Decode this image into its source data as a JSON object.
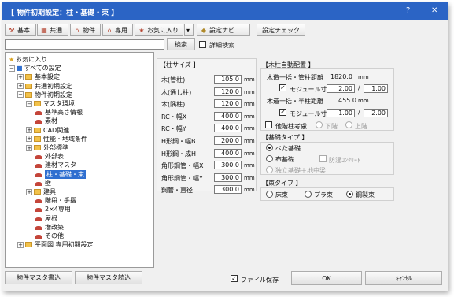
{
  "window": {
    "title": "【 物件初期設定：柱・基礎・束 】",
    "help_label": "?",
    "close_label": "✕"
  },
  "toolbar": [
    {
      "icon": "tool-icon",
      "glyph": "⚒",
      "label": "基本"
    },
    {
      "icon": "grid-icon",
      "glyph": "▦",
      "label": "共通"
    },
    {
      "icon": "house-icon",
      "glyph": "⌂",
      "label": "物件"
    },
    {
      "icon": "house-icon",
      "glyph": "⌂",
      "label": "専用"
    },
    {
      "icon": "star-icon",
      "glyph": "★",
      "label": "お気に入り"
    }
  ],
  "toolbar_dropdown": "▾",
  "nav_button": "設定ナビ",
  "check_button": "設定チェック",
  "search": {
    "value": "",
    "button": "検索",
    "detail_label": "詳細検索"
  },
  "tree": [
    {
      "label": "お気に入り",
      "kind": "star",
      "indent": 0,
      "pm": ""
    },
    {
      "label": "すべての設定",
      "kind": "book",
      "indent": 0,
      "pm": "−"
    },
    {
      "label": "基本設定",
      "kind": "folder",
      "indent": 1,
      "pm": "+"
    },
    {
      "label": "共通初期設定",
      "kind": "folder",
      "indent": 1,
      "pm": "+"
    },
    {
      "label": "物件初期設定",
      "kind": "folder",
      "indent": 1,
      "pm": "−"
    },
    {
      "label": "マスタ環境",
      "kind": "folder",
      "indent": 2,
      "pm": "−"
    },
    {
      "label": "基準高さ情報",
      "kind": "hat",
      "indent": 3,
      "pm": ""
    },
    {
      "label": "素材",
      "kind": "hat",
      "indent": 3,
      "pm": ""
    },
    {
      "label": "CAD関連",
      "kind": "folder",
      "indent": 2,
      "pm": "+"
    },
    {
      "label": "性能・地域条件",
      "kind": "folder",
      "indent": 2,
      "pm": "+"
    },
    {
      "label": "外部標準",
      "kind": "folder",
      "indent": 2,
      "pm": "+"
    },
    {
      "label": "外部表",
      "kind": "hat",
      "indent": 3,
      "pm": ""
    },
    {
      "label": "建材マスタ",
      "kind": "hat",
      "indent": 3,
      "pm": ""
    },
    {
      "label": "柱・基礎・束",
      "kind": "hat",
      "indent": 3,
      "pm": "",
      "selected": true
    },
    {
      "label": "壁",
      "kind": "hat",
      "indent": 3,
      "pm": ""
    },
    {
      "label": "建具",
      "kind": "folder",
      "indent": 2,
      "pm": "+"
    },
    {
      "label": "階段・手摺",
      "kind": "hat",
      "indent": 3,
      "pm": ""
    },
    {
      "label": "2×4専用",
      "kind": "hat",
      "indent": 3,
      "pm": ""
    },
    {
      "label": "屋根",
      "kind": "hat",
      "indent": 3,
      "pm": ""
    },
    {
      "label": "増改築",
      "kind": "hat",
      "indent": 3,
      "pm": ""
    },
    {
      "label": "その他",
      "kind": "hat",
      "indent": 3,
      "pm": ""
    },
    {
      "label": "平面図 専用初期設定",
      "kind": "folder",
      "indent": 1,
      "pm": "+"
    }
  ],
  "pillar_size": {
    "title": "【柱サイズ 】",
    "unit": "mm",
    "rows": [
      {
        "label": "木(管柱)",
        "value": "105.0"
      },
      {
        "label": "木(通し柱)",
        "value": "120.0"
      },
      {
        "label": "木(隅柱)",
        "value": "120.0"
      },
      {
        "label": "RC・幅X",
        "value": "400.0"
      },
      {
        "label": "RC・幅Y",
        "value": "400.0"
      },
      {
        "label": "H形鋼・幅B",
        "value": "200.0"
      },
      {
        "label": "H形鋼・成H",
        "value": "400.0"
      },
      {
        "label": "角形鋼管・幅X",
        "value": "300.0"
      },
      {
        "label": "角形鋼管・幅Y",
        "value": "300.0"
      },
      {
        "label": "鋼管・直径",
        "value": "300.0"
      }
    ]
  },
  "auto_place": {
    "title": "【木柱自動配置 】",
    "pitch_label": "木造一括・管柱距離",
    "pitch_value": "1820.0",
    "pitch_unit": "mm",
    "module_label": "モジュール寸法",
    "module_a": "2.00",
    "module_b": "1.00",
    "half_label": "木造一括・半柱距離",
    "half_value": "455.0",
    "half_unit": "mm",
    "module2_a": "1.00",
    "module2_b": "2.00",
    "slash": "/",
    "other_floor_label": "他階柱考慮",
    "lower_label": "下階",
    "upper_label": "上階"
  },
  "foundation": {
    "title": "【基礎タイプ 】",
    "options": [
      "べた基礎",
      "布基礎",
      "独立基礎＋地中梁"
    ],
    "waterproof_label": "防湿ｺﾝｸﾘｰﾄ",
    "selected": 0
  },
  "strut": {
    "title": "【束タイプ 】",
    "options": [
      "床束",
      "プラ束",
      "鋼製束"
    ],
    "selected": 2
  },
  "footer": {
    "master_write": "物件マスタ書込",
    "master_read": "物件マスタ読込",
    "save_file": "ファイル保存",
    "ok": "OK",
    "cancel": "ｷｬﾝｾﾙ"
  }
}
